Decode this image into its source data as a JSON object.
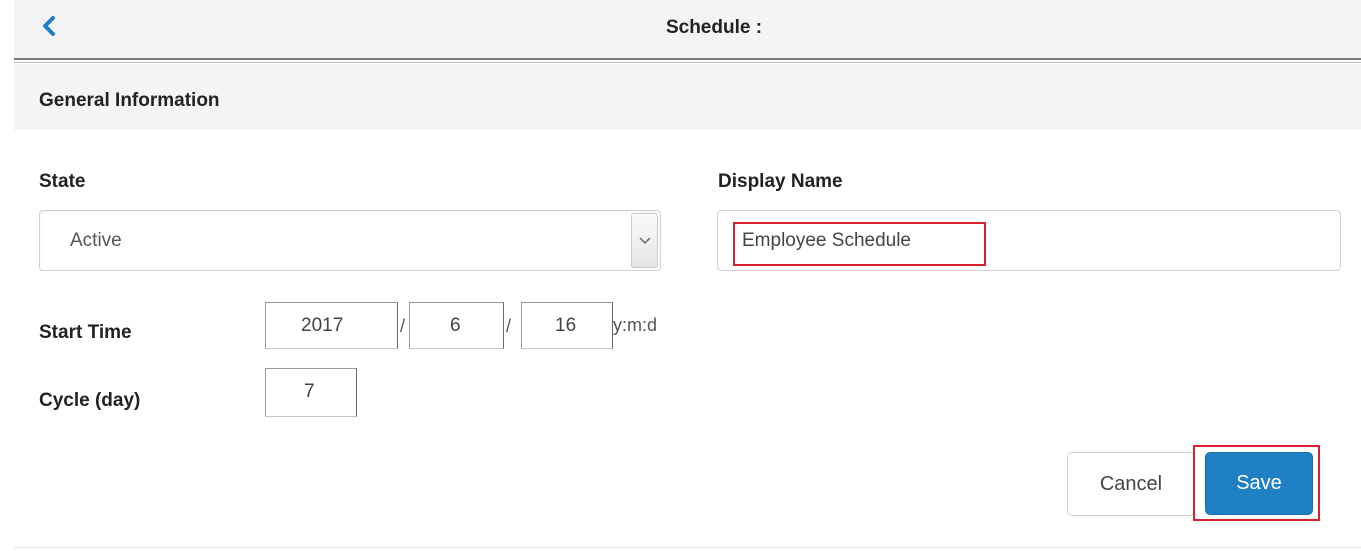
{
  "header": {
    "title": "Schedule :",
    "back_icon": "chevron-left-icon"
  },
  "section": {
    "title": "General Information"
  },
  "form": {
    "state": {
      "label": "State",
      "value": "Active",
      "caret_icon": "chevron-down-icon"
    },
    "display_name": {
      "label": "Display Name",
      "value": "Employee Schedule"
    },
    "start_time": {
      "label": "Start Time",
      "year": "2017",
      "month": "6",
      "day": "16",
      "separator": "/",
      "format_hint": "y:m:d"
    },
    "cycle": {
      "label": "Cycle (day)",
      "value": "7"
    }
  },
  "actions": {
    "cancel_label": "Cancel",
    "save_label": "Save"
  },
  "colors": {
    "accent": "#1f80c3",
    "highlight": "#d8202e",
    "back_icon": "#1f80c3"
  }
}
